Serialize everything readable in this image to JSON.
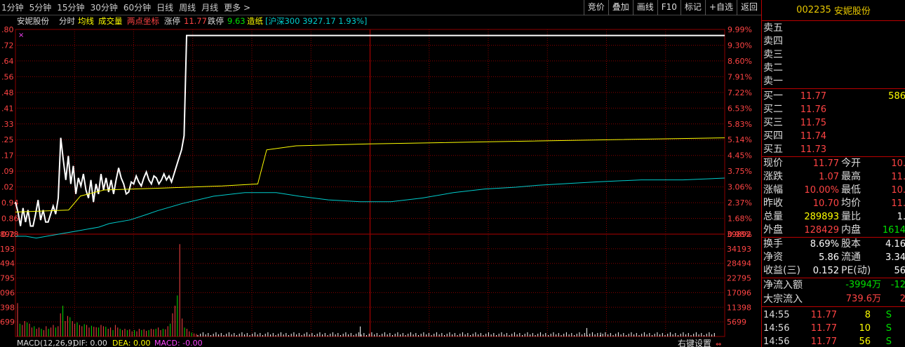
{
  "toolbar": {
    "tabs": [
      "1分钟",
      "5分钟",
      "15分钟",
      "30分钟",
      "60分钟",
      "日线",
      "周线",
      "月线",
      "更多 >"
    ],
    "buttons": [
      "竞价",
      "叠加",
      "画线",
      "F10",
      "标记",
      "+自选",
      "返回"
    ]
  },
  "chart_info": {
    "stock_name": "安妮股份",
    "mode": "分时",
    "avg_line_label": "均线",
    "volume_label": "成交量",
    "two_point_label": "两点坐标",
    "limit_up_label": "涨停",
    "limit_up_value": "11.77",
    "limit_down_label": "跌停",
    "limit_down_value": "9.63",
    "sector_label": "造纸",
    "index_info": "[沪深300 3927.17 1.93%]"
  },
  "chart_data": {
    "type": "line",
    "price_axis_left": [
      ".80",
      ".72",
      ".64",
      ".56",
      ".48",
      ".41",
      ".33",
      ".25",
      ".17",
      ".09",
      ".02",
      "0.94",
      "0.86",
      "0.78"
    ],
    "price_axis_right": [
      "9.99%",
      "9.30%",
      "8.60%",
      "7.91%",
      "7.22%",
      "6.53%",
      "5.83%",
      "5.14%",
      "4.45%",
      "3.75%",
      "3.06%",
      "2.37%",
      "1.68%",
      "0.98%"
    ],
    "volume_axis_left": [
      "892",
      "193",
      "494",
      "795",
      "096",
      "398",
      "699"
    ],
    "volume_axis_right": [
      "39892",
      "34193",
      "28494",
      "22795",
      "17096",
      "11398",
      "5699"
    ],
    "prev_close": 10.7,
    "limit_up": 11.77,
    "price_min": 10.78,
    "price_max": 11.8,
    "volume_max": 39892,
    "price_series": [
      10.94,
      10.89,
      10.82,
      10.91,
      10.84,
      10.9,
      10.82,
      10.82,
      10.88,
      10.95,
      10.85,
      10.9,
      10.84,
      10.84,
      10.88,
      10.92,
      10.88,
      10.96,
      11.26,
      11.15,
      11.05,
      11.17,
      11.03,
      11.12,
      10.98,
      11.06,
      11.02,
      11.08,
      11.0,
      10.96,
      11.05,
      10.94,
      11.03,
      10.98,
      11.08,
      11.0,
      11.06,
      10.99,
      11.05,
      10.98,
      11.05,
      11.11,
      11.06,
      11.03,
      10.98,
      10.99,
      11.04,
      11.03,
      11.07,
      11.04,
      11.02,
      11.06,
      11.09,
      11.05,
      11.03,
      11.07,
      11.06,
      11.03,
      11.05,
      11.08,
      11.05,
      11.07,
      11.04,
      11.08,
      11.12,
      11.16,
      11.2,
      11.27,
      11.77
    ],
    "price_series_end": 11.77,
    "avg_series": [
      [
        0,
        10.89
      ],
      [
        18,
        10.9
      ],
      [
        22,
        10.97
      ],
      [
        30,
        11.0
      ],
      [
        50,
        11.01
      ],
      [
        70,
        11.02
      ],
      [
        82,
        11.03
      ],
      [
        85,
        11.2
      ],
      [
        95,
        11.22
      ],
      [
        120,
        11.23
      ],
      [
        160,
        11.24
      ],
      [
        240,
        11.26
      ]
    ],
    "index_series": [
      [
        0,
        0.62
      ],
      [
        5,
        0.62
      ],
      [
        10,
        0.63
      ],
      [
        20,
        0.61
      ],
      [
        30,
        0.59
      ],
      [
        40,
        0.57
      ],
      [
        45,
        0.55
      ],
      [
        55,
        0.53
      ],
      [
        63,
        0.5
      ],
      [
        68,
        0.48
      ],
      [
        80,
        0.44
      ],
      [
        95,
        0.4
      ],
      [
        110,
        0.38
      ],
      [
        125,
        0.38
      ],
      [
        136,
        0.4
      ],
      [
        150,
        0.42
      ],
      [
        165,
        0.43
      ],
      [
        180,
        0.43
      ],
      [
        195,
        0.41
      ],
      [
        210,
        0.38
      ],
      [
        225,
        0.36
      ],
      [
        240,
        0.35
      ],
      [
        250,
        0.34
      ],
      [
        265,
        0.33
      ],
      [
        280,
        0.32
      ],
      [
        300,
        0.31
      ],
      [
        320,
        0.31
      ],
      [
        340,
        0.3
      ]
    ],
    "volumes": [
      13000,
      5000,
      4500,
      6000,
      5500,
      5000,
      3500,
      4000,
      3000,
      3500,
      3000,
      2500,
      4000,
      3000,
      3500,
      4500,
      3500,
      4000,
      9000,
      12000,
      6000,
      8000,
      7500,
      6000,
      5000,
      5500,
      4500,
      4000,
      4800,
      4500,
      3500,
      4200,
      3800,
      3600,
      3500,
      4500,
      4000,
      3800,
      3000,
      3500,
      2500,
      4500,
      3500,
      3000,
      2500,
      3000,
      2500,
      2800,
      2000,
      2500,
      2000,
      3000,
      2500,
      2800,
      2200,
      2500,
      3000,
      2800,
      3000,
      3500,
      2500,
      3000,
      2800,
      4000,
      5000,
      9000,
      12000,
      16000,
      36000,
      7000,
      3500,
      3000,
      2000,
      1500,
      1200,
      1000
    ],
    "spike_volumes": [
      [
        175,
        3900
      ],
      [
        290,
        3300
      ],
      [
        297,
        1500
      ]
    ],
    "macd_label": "MACD(12,26,9)",
    "dif_label": "DIF: 0.00",
    "dea_label": "DEA: 0.00",
    "macd_value_label": "MACD: -0.00",
    "right_settings": "右键设置"
  },
  "quote": {
    "code": "002235",
    "name": "安妮股份",
    "sell": [
      {
        "label": "卖五",
        "price": "",
        "vol": ""
      },
      {
        "label": "卖四",
        "price": "",
        "vol": ""
      },
      {
        "label": "卖三",
        "price": "",
        "vol": ""
      },
      {
        "label": "卖二",
        "price": "",
        "vol": ""
      },
      {
        "label": "卖一",
        "price": "",
        "vol": ""
      }
    ],
    "buy": [
      {
        "label": "买一",
        "price": "11.77",
        "vol": "586"
      },
      {
        "label": "买二",
        "price": "11.76",
        "vol": ""
      },
      {
        "label": "买三",
        "price": "11.75",
        "vol": ""
      },
      {
        "label": "买四",
        "price": "11.74",
        "vol": ""
      },
      {
        "label": "买五",
        "price": "11.73",
        "vol": ""
      }
    ],
    "stats": [
      {
        "l1": "现价",
        "v1": "11.77",
        "l2": "今开",
        "v2": "10."
      },
      {
        "l1": "涨跌",
        "v1": "1.07",
        "l2": "最高",
        "v2": "11."
      },
      {
        "l1": "涨幅",
        "v1": "10.00%",
        "l2": "最低",
        "v2": "10."
      },
      {
        "l1": "昨收",
        "v1": "10.70",
        "l2": "均价",
        "v2": "11."
      },
      {
        "l1": "总量",
        "v1": "289893",
        "l2": "量比",
        "v2": "1."
      },
      {
        "l1": "外盘",
        "v1": "128429",
        "l2": "内盘",
        "v2": "1614"
      }
    ],
    "stats2": [
      {
        "l1": "换手",
        "v1": "8.69%",
        "l2": "股本",
        "v2": "4.16"
      },
      {
        "l1": "净资",
        "v1": "5.86",
        "l2": "流通",
        "v2": "3.34"
      },
      {
        "l1": "收益(三)",
        "v1": "0.152",
        "l2": "PE(动)",
        "v2": "56"
      }
    ],
    "flow": [
      {
        "label": "净流入额",
        "value": "-3994万",
        "extra": "-12"
      },
      {
        "label": "大宗流入",
        "value": "739.6万",
        "extra": "2"
      }
    ],
    "ticks": [
      {
        "time": "14:55",
        "price": "11.77",
        "vol": "8",
        "side": "S"
      },
      {
        "time": "14:56",
        "price": "11.77",
        "vol": "10",
        "side": "S"
      },
      {
        "time": "14:56",
        "price": "11.77",
        "vol": "56",
        "side": "S"
      }
    ],
    "colors": {
      "up": "#ff4444",
      "down": "#00e000",
      "grid": "#8b0000",
      "price_line": "#ffffff",
      "avg_line": "#ffff00",
      "index_line": "#00cccc",
      "header": "#e8c800"
    }
  }
}
